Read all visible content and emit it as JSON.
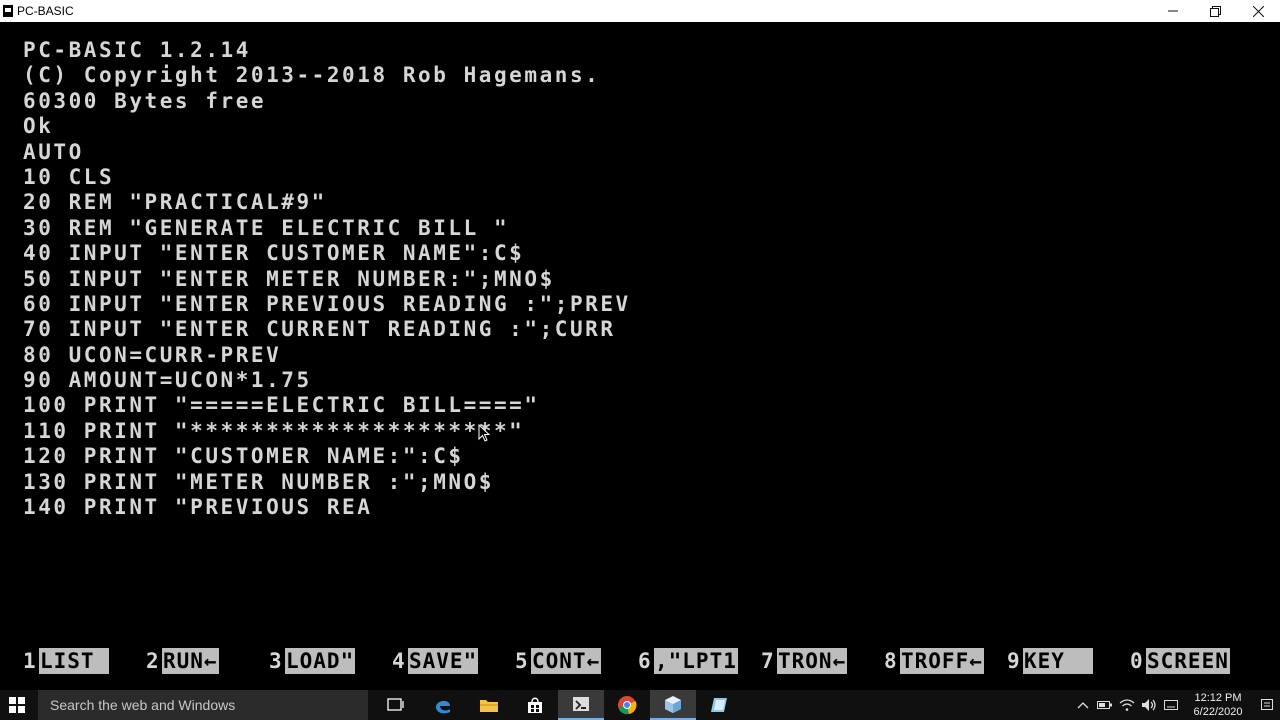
{
  "window": {
    "title": "PC-BASIC"
  },
  "console": {
    "lines": [
      "PC-BASIC 1.2.14",
      "(C) Copyright 2013--2018 Rob Hagemans.",
      "60300 Bytes free",
      "Ok",
      "AUTO",
      "10 CLS",
      "20 REM \"PRACTICAL#9\"",
      "30 REM \"GENERATE ELECTRIC BILL \"",
      "40 INPUT \"ENTER CUSTOMER NAME\":C$",
      "50 INPUT \"ENTER METER NUMBER:\";MNO$",
      "60 INPUT \"ENTER PREVIOUS READING :\";PREV",
      "70 INPUT \"ENTER CURRENT READING :\";CURR",
      "80 UCON=CURR-PREV",
      "90 AMOUNT=UCON*1.75",
      "100 PRINT \"=====ELECTRIC BILL====\"",
      "110 PRINT \"*********************\"",
      "120 PRINT \"CUSTOMER NAME:\":C$",
      "130 PRINT \"METER NUMBER :\";MNO$",
      "140 PRINT \"PREVIOUS REA"
    ]
  },
  "function_keys": [
    {
      "num": "1",
      "label": "LIST "
    },
    {
      "num": "2",
      "label": "RUN←"
    },
    {
      "num": "3",
      "label": "LOAD\""
    },
    {
      "num": "4",
      "label": "SAVE\""
    },
    {
      "num": "5",
      "label": "CONT←"
    },
    {
      "num": "6",
      "label": ",\"LPT1"
    },
    {
      "num": "7",
      "label": "TRON←"
    },
    {
      "num": "8",
      "label": "TROFF←"
    },
    {
      "num": "9",
      "label": "KEY  "
    },
    {
      "num": "0",
      "label": "SCREEN"
    }
  ],
  "taskbar": {
    "search_placeholder": "Search the web and Windows",
    "time": "12:12 PM",
    "date": "6/22/2020"
  },
  "colors": {
    "console_bg": "#000000",
    "console_text": "#d6d6d6",
    "fkey_bg": "#bdbdbd",
    "taskbar_bg": "#101010"
  }
}
